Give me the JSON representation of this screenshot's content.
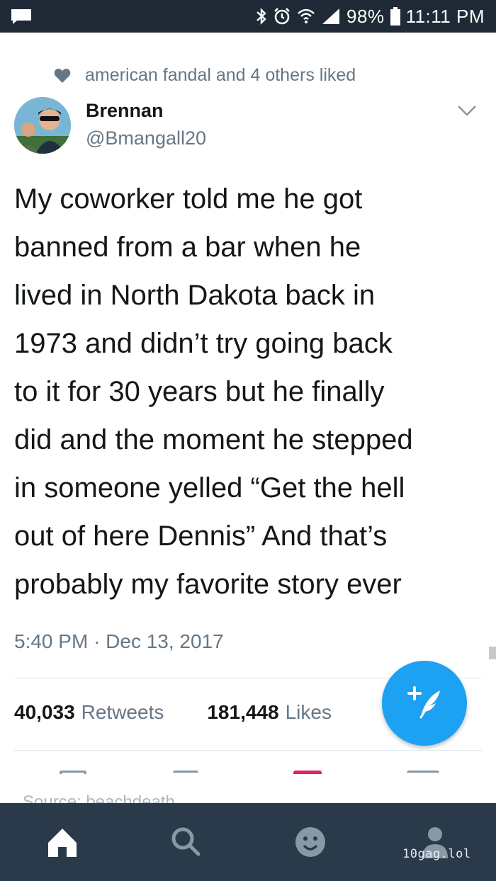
{
  "status_bar": {
    "battery_percent": "98%",
    "time": "11:11 PM",
    "icons": [
      "message-icon",
      "bluetooth-icon",
      "alarm-icon",
      "wifi-icon",
      "signal-icon",
      "battery-icon"
    ]
  },
  "social_context": {
    "icon": "heart-icon",
    "text": "american fandal and 4 others liked"
  },
  "author": {
    "name": "Brennan",
    "handle": "@Bmangall20"
  },
  "tweet": {
    "lines": [
      "My coworker told me he got",
      "banned from a bar when he",
      "lived in North Dakota back in",
      "1973 and didn’t try going back",
      "to it for 30 years but he finally",
      "did and the moment he stepped",
      "in someone yelled “Get the hell",
      "out of here Dennis” And that’s",
      "probably my favorite story ever"
    ],
    "timestamp": "5:40 PM · Dec 13, 2017"
  },
  "stats": {
    "retweets_count": "40,033",
    "retweets_label": "Retweets",
    "likes_count": "181,448",
    "likes_label": "Likes"
  },
  "source": "Source: beachdeath",
  "bottom_nav": {
    "items": [
      "home-icon",
      "search-icon",
      "moments-icon",
      "profile-icon"
    ]
  },
  "watermark": "10gag.lol",
  "colors": {
    "status_bar": "#1f2a36",
    "nav_bar": "#2b3a4a",
    "accent": "#1da1f2",
    "secondary_text": "#657786"
  }
}
